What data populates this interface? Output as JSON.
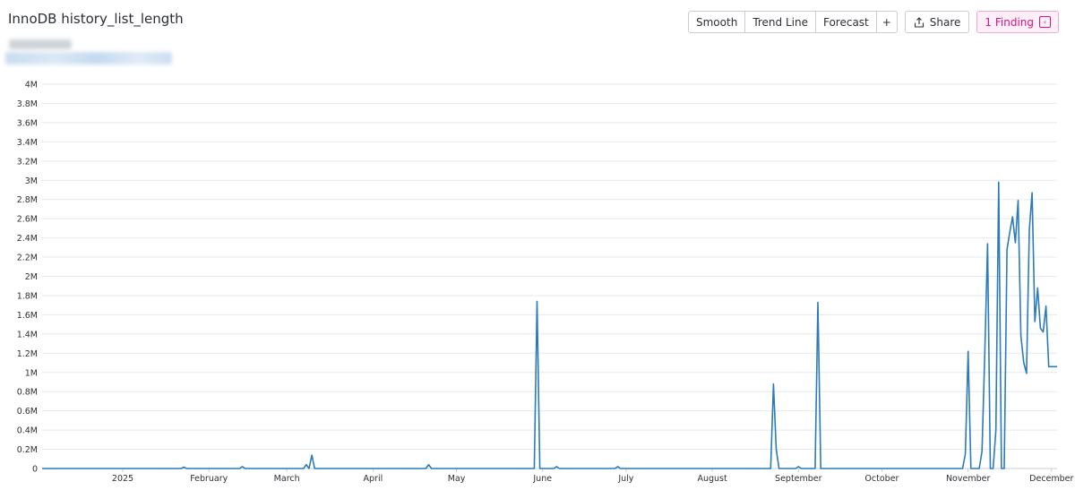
{
  "header": {
    "title": "InnoDB history_list_length"
  },
  "toolbar": {
    "smooth_label": "Smooth",
    "trend_label": "Trend Line",
    "forecast_label": "Forecast",
    "add_label": "+",
    "share_label": "Share",
    "finding_label": "1 Finding"
  },
  "colors": {
    "line": "#2b7bb9",
    "grid": "#e6e8eb",
    "finding": "#d6157f"
  },
  "chart_data": {
    "type": "line",
    "ylim": [
      0,
      4000000
    ],
    "y_ticks": [
      {
        "v": 0,
        "label": "0"
      },
      {
        "v": 200000,
        "label": "0.2M"
      },
      {
        "v": 400000,
        "label": "0.4M"
      },
      {
        "v": 600000,
        "label": "0.6M"
      },
      {
        "v": 800000,
        "label": "0.8M"
      },
      {
        "v": 1000000,
        "label": "1M"
      },
      {
        "v": 1200000,
        "label": "1.2M"
      },
      {
        "v": 1400000,
        "label": "1.4M"
      },
      {
        "v": 1600000,
        "label": "1.6M"
      },
      {
        "v": 1800000,
        "label": "1.8M"
      },
      {
        "v": 2000000,
        "label": "2M"
      },
      {
        "v": 2200000,
        "label": "2.2M"
      },
      {
        "v": 2400000,
        "label": "2.4M"
      },
      {
        "v": 2600000,
        "label": "2.6M"
      },
      {
        "v": 2800000,
        "label": "2.8M"
      },
      {
        "v": 3000000,
        "label": "3M"
      },
      {
        "v": 3200000,
        "label": "3.2M"
      },
      {
        "v": 3400000,
        "label": "3.4M"
      },
      {
        "v": 3600000,
        "label": "3.6M"
      },
      {
        "v": 3800000,
        "label": "3.8M"
      },
      {
        "v": 4000000,
        "label": "4M"
      }
    ],
    "xlim": [
      "2024-12-03",
      "2025-12-03"
    ],
    "x_ticks": [
      {
        "date": "2025-01-01",
        "label": "2025"
      },
      {
        "date": "2025-02-01",
        "label": "February"
      },
      {
        "date": "2025-03-01",
        "label": "March"
      },
      {
        "date": "2025-04-01",
        "label": "April"
      },
      {
        "date": "2025-05-01",
        "label": "May"
      },
      {
        "date": "2025-06-01",
        "label": "June"
      },
      {
        "date": "2025-07-01",
        "label": "July"
      },
      {
        "date": "2025-08-01",
        "label": "August"
      },
      {
        "date": "2025-09-01",
        "label": "September"
      },
      {
        "date": "2025-10-01",
        "label": "October"
      },
      {
        "date": "2025-11-01",
        "label": "November"
      },
      {
        "date": "2025-12-01",
        "label": "December"
      }
    ],
    "grid": true,
    "series": [
      {
        "x": [
          "2024-12-03",
          "2025-01-22",
          "2025-01-23",
          "2025-01-24",
          "2025-02-12",
          "2025-02-13",
          "2025-02-14",
          "2025-03-07",
          "2025-03-08",
          "2025-03-09",
          "2025-03-10",
          "2025-03-11",
          "2025-03-12",
          "2025-03-13",
          "2025-04-20",
          "2025-04-21",
          "2025-04-22",
          "2025-05-29",
          "2025-05-30",
          "2025-05-31",
          "2025-06-05",
          "2025-06-06",
          "2025-06-07",
          "2025-06-27",
          "2025-06-28",
          "2025-06-29",
          "2025-08-22",
          "2025-08-23",
          "2025-08-24",
          "2025-08-25",
          "2025-08-26",
          "2025-08-31",
          "2025-09-01",
          "2025-09-02",
          "2025-09-07",
          "2025-09-08",
          "2025-09-09",
          "2025-10-30",
          "2025-10-31",
          "2025-11-01",
          "2025-11-02",
          "2025-11-05",
          "2025-11-06",
          "2025-11-07",
          "2025-11-08",
          "2025-11-09",
          "2025-11-10",
          "2025-11-11",
          "2025-11-12",
          "2025-11-13",
          "2025-11-14",
          "2025-11-15",
          "2025-11-16",
          "2025-11-17",
          "2025-11-18",
          "2025-11-19",
          "2025-11-20",
          "2025-11-21",
          "2025-11-22",
          "2025-11-23",
          "2025-11-24",
          "2025-11-25",
          "2025-11-26",
          "2025-11-27",
          "2025-11-28",
          "2025-11-29",
          "2025-11-30",
          "2025-12-01",
          "2025-12-02",
          "2025-12-03"
        ],
        "y": [
          0,
          0,
          15000,
          0,
          0,
          20000,
          0,
          0,
          40000,
          0,
          140000,
          0,
          0,
          0,
          0,
          40000,
          0,
          0,
          1740000,
          0,
          0,
          20000,
          0,
          0,
          20000,
          0,
          0,
          880000,
          200000,
          0,
          0,
          0,
          20000,
          0,
          0,
          1730000,
          0,
          0,
          150000,
          1220000,
          0,
          0,
          180000,
          1200000,
          2340000,
          0,
          0,
          400000,
          2980000,
          0,
          0,
          2280000,
          2460000,
          2620000,
          2350000,
          2790000,
          1380000,
          1100000,
          990000,
          2480000,
          2870000,
          1530000,
          1880000,
          1460000,
          1420000,
          1690000,
          1060000,
          1060000,
          1060000,
          1060000
        ]
      }
    ]
  }
}
